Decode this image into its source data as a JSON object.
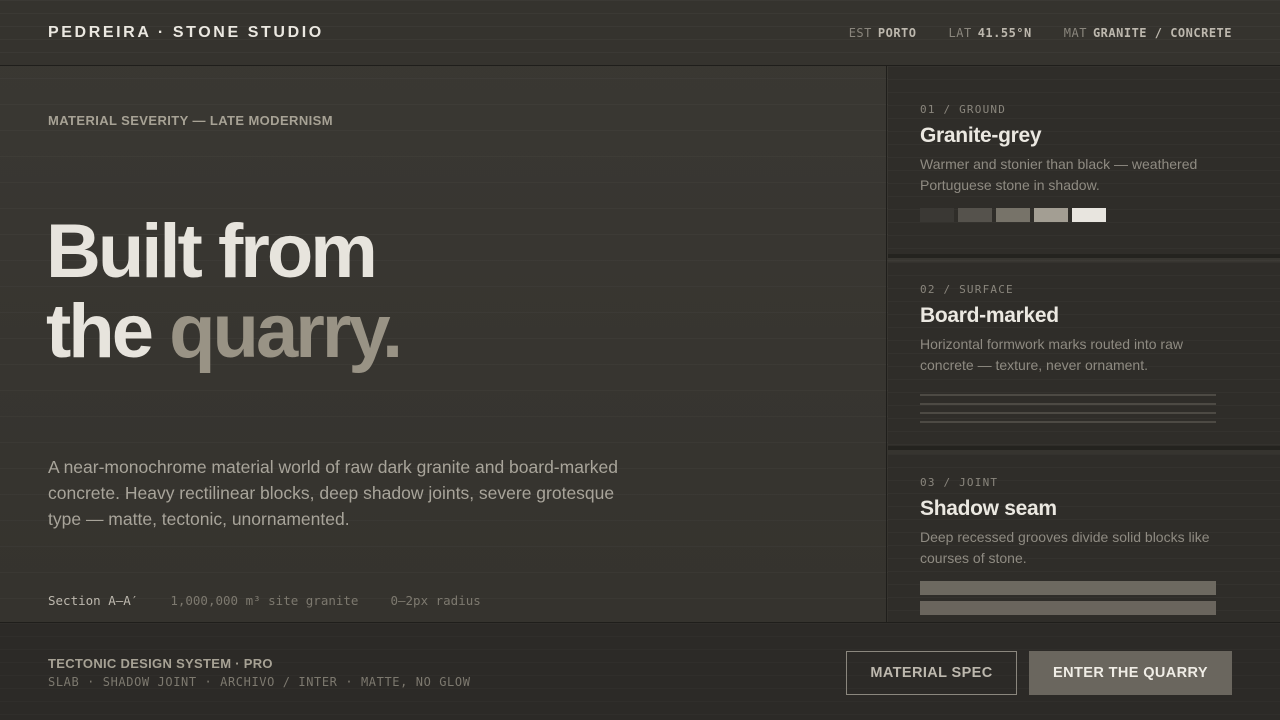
{
  "header": {
    "brand": "PEDREIRA · STONE STUDIO",
    "meta": [
      {
        "key": "EST",
        "value": "PORTO"
      },
      {
        "key": "LAT",
        "value": "41.55°N"
      },
      {
        "key": "MAT",
        "value": "GRANITE / CONCRETE"
      }
    ]
  },
  "hero": {
    "eyebrow": "MATERIAL SEVERITY — LATE MODERNISM",
    "headline_line1": "Built from",
    "headline_line2_a": "the",
    "headline_line2_b": "quarry.",
    "lead": "A near-monochrome material world of raw dark granite and board-marked concrete. Heavy rectilinear blocks, deep shadow joints, severe grotesque type — matte, tectonic, unornamented.",
    "specs": [
      "Section A–A′",
      "1,000,000 m³ site granite",
      "0–2px radius"
    ]
  },
  "cards": [
    {
      "num": "01 / GROUND",
      "title": "Granite-grey",
      "desc": "Warmer and stonier than black — weathered Portuguese stone in shadow.",
      "swatches": [
        "#3a3834",
        "#55524c",
        "#777369",
        "#a39e93",
        "#e8e5df"
      ]
    },
    {
      "num": "02 / SURFACE",
      "title": "Board-marked",
      "desc": "Horizontal formwork marks routed into raw concrete — texture, never ornament."
    },
    {
      "num": "03 / JOINT",
      "title": "Shadow seam",
      "desc": "Deep recessed grooves divide solid blocks like courses of stone."
    }
  ],
  "footer": {
    "title": "TECTONIC DESIGN SYSTEM · PRO",
    "tags": "SLAB · SHADOW JOINT · ARCHIVO / INTER · MATTE, NO GLOW",
    "btn_secondary": "MATERIAL SPEC",
    "btn_primary": "ENTER THE QUARRY"
  },
  "colors": {
    "background": "#34322d",
    "text_primary": "#e7e4dd",
    "accent_stone": "#999385",
    "button_primary_bg": "#6a665e"
  }
}
